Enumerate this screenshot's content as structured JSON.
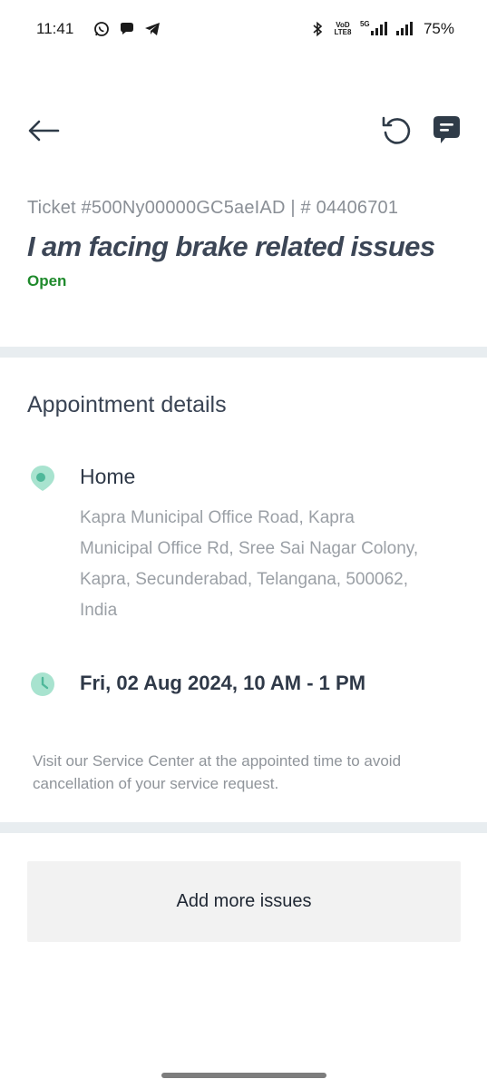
{
  "status_bar": {
    "time": "11:41",
    "notification_icons": [
      "whatsapp-icon",
      "chat-bubble-icon",
      "telegram-icon"
    ],
    "network_label_top": "VoD",
    "network_label_bottom": "LTE8",
    "network_5g": "5G",
    "battery": "75%"
  },
  "app_bar": {
    "back_icon": "back-arrow-icon",
    "refresh_icon": "refresh-icon",
    "chat_icon": "chat-icon",
    "accent_color": "#2f3b48"
  },
  "ticket": {
    "number_line": "Ticket #500Ny00000GC5aeIAD | # 04406701",
    "title": "I am facing brake related issues",
    "status": "Open",
    "status_color": "#1f8a2c"
  },
  "appointment": {
    "heading": "Appointment details",
    "location_name": "Home",
    "address": "Kapra Municipal Office Road, Kapra Municipal Office Rd, Sree Sai Nagar Colony, Kapra, Secunderabad, Telangana, 500062, India",
    "datetime": "Fri, 02 Aug 2024, 10 AM - 1 PM",
    "note": "Visit our Service Center at the appointed time to avoid cancellation of your service request.",
    "icon_color": "#a8e3cf"
  },
  "actions": {
    "add_more_issues": "Add more issues"
  }
}
